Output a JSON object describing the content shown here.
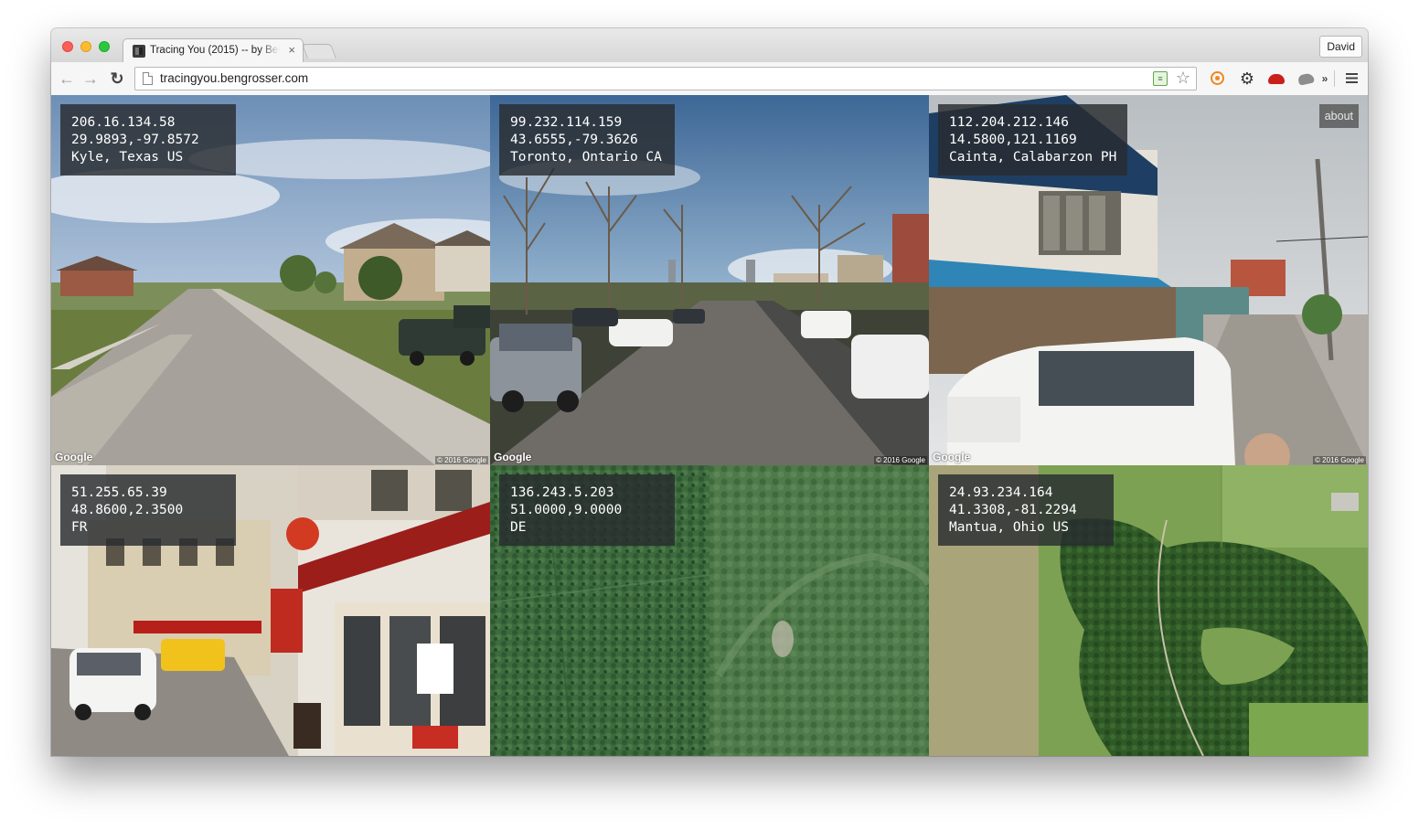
{
  "browser": {
    "tab_title": "Tracing You (2015) -- by Ben Grosser",
    "tab_close": "×",
    "profile_name": "David",
    "url": "tracingyou.bengrosser.com",
    "back_glyph": "←",
    "forward_glyph": "→",
    "reload_glyph": "↻",
    "extensions_overflow": "»",
    "icons": [
      "back-arrow-icon",
      "forward-arrow-icon",
      "reload-icon",
      "page-icon",
      "rss-icon",
      "star-icon",
      "extension-orange-icon",
      "gear-icon",
      "extension-red-icon",
      "extension-grey-icon",
      "menu-icon"
    ]
  },
  "page": {
    "about_label": "about",
    "google_label": "Google",
    "copyright_label": "© 2016 Google",
    "tiles": [
      {
        "ip": "206.16.134.58",
        "coords": "29.9893,-97.8572",
        "place": "Kyle, Texas US",
        "scene": "street-suburb"
      },
      {
        "ip": "99.232.114.159",
        "coords": "43.6555,-79.3626",
        "place": "Toronto, Ontario CA",
        "scene": "street-city"
      },
      {
        "ip": "112.204.212.146",
        "coords": "14.5800,121.1169",
        "place": "Cainta, Calabarzon PH",
        "scene": "street-village"
      },
      {
        "ip": "51.255.65.39",
        "coords": "48.8600,2.3500",
        "place": "FR",
        "scene": "street-paris"
      },
      {
        "ip": "136.243.5.203",
        "coords": "51.0000,9.0000",
        "place": "DE",
        "scene": "satellite-forest"
      },
      {
        "ip": "24.93.234.164",
        "coords": "41.3308,-81.2294",
        "place": "Mantua, Ohio US",
        "scene": "satellite-farmland"
      }
    ]
  }
}
